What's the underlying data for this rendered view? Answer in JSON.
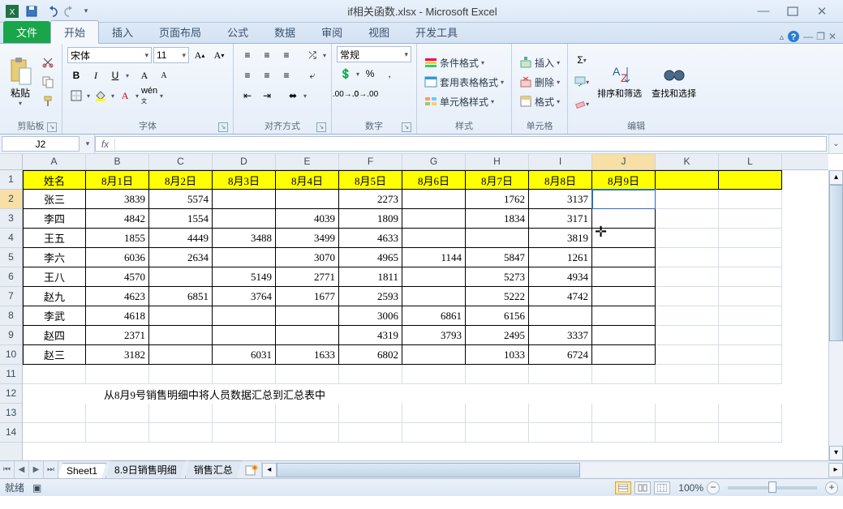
{
  "title_bar": {
    "doc_title": "if相关函数.xlsx - Microsoft Excel"
  },
  "ribbon": {
    "file_tab": "文件",
    "tabs": [
      "开始",
      "插入",
      "页面布局",
      "公式",
      "数据",
      "审阅",
      "视图",
      "开发工具"
    ],
    "active_tab": 0,
    "clipboard": {
      "label": "剪贴板",
      "paste": "粘贴"
    },
    "font": {
      "label": "字体",
      "name": "宋体",
      "size": "11",
      "bold": "B",
      "italic": "I",
      "underline": "U"
    },
    "alignment": {
      "label": "对齐方式"
    },
    "number": {
      "label": "数字",
      "format": "常规",
      "percent": "%"
    },
    "styles": {
      "label": "样式",
      "conditional": "条件格式",
      "table_format": "套用表格格式",
      "cell_styles": "单元格样式"
    },
    "cells": {
      "label": "单元格",
      "insert": "插入",
      "delete": "删除",
      "format": "格式"
    },
    "editing": {
      "label": "编辑",
      "sort": "排序和筛选",
      "find": "查找和选择"
    }
  },
  "formula_bar": {
    "name_box": "J2",
    "fx": "fx",
    "formula": ""
  },
  "grid": {
    "columns": [
      "A",
      "B",
      "C",
      "D",
      "E",
      "F",
      "G",
      "H",
      "I",
      "J",
      "K",
      "L"
    ],
    "active_col_index": 9,
    "row_headers": [
      1,
      2,
      3,
      4,
      5,
      6,
      7,
      8,
      9,
      10,
      11,
      12,
      13,
      14
    ],
    "active_row_index": 1,
    "header_row": [
      "姓名",
      "8月1日",
      "8月2日",
      "8月3日",
      "8月4日",
      "8月5日",
      "8月6日",
      "8月7日",
      "8月8日",
      "8月9日"
    ],
    "data_rows": [
      [
        "张三",
        "3839",
        "5574",
        "",
        "",
        "2273",
        "",
        "1762",
        "3137",
        ""
      ],
      [
        "李四",
        "4842",
        "1554",
        "",
        "4039",
        "1809",
        "",
        "1834",
        "3171",
        ""
      ],
      [
        "王五",
        "1855",
        "4449",
        "3488",
        "3499",
        "4633",
        "",
        "",
        "3819",
        ""
      ],
      [
        "李六",
        "6036",
        "2634",
        "",
        "3070",
        "4965",
        "1144",
        "5847",
        "1261",
        ""
      ],
      [
        "王八",
        "4570",
        "",
        "5149",
        "2771",
        "1811",
        "",
        "5273",
        "4934",
        ""
      ],
      [
        "赵九",
        "4623",
        "6851",
        "3764",
        "1677",
        "2593",
        "",
        "5222",
        "4742",
        ""
      ],
      [
        "李武",
        "4618",
        "",
        "",
        "",
        "3006",
        "6861",
        "6156",
        "",
        ""
      ],
      [
        "赵四",
        "2371",
        "",
        "",
        "",
        "4319",
        "3793",
        "2495",
        "3337",
        ""
      ],
      [
        "赵三",
        "3182",
        "",
        "6031",
        "1633",
        "6802",
        "",
        "1033",
        "6724",
        ""
      ]
    ],
    "selected": {
      "row": 2,
      "col": "J"
    },
    "note": "从8月9号销售明细中将人员数据汇总到汇总表中"
  },
  "sheet_tabs": {
    "sheets": [
      "Sheet1",
      "8.9日销售明细",
      "销售汇总"
    ],
    "active": 0
  },
  "status_bar": {
    "ready": "就绪",
    "zoom": "100%"
  },
  "chart_data": {
    "type": "table",
    "title": "8月1日–8月9日 人员销售明细",
    "columns": [
      "姓名",
      "8月1日",
      "8月2日",
      "8月3日",
      "8月4日",
      "8月5日",
      "8月6日",
      "8月7日",
      "8月8日",
      "8月9日"
    ],
    "rows": [
      {
        "姓名": "张三",
        "8月1日": 3839,
        "8月2日": 5574,
        "8月3日": null,
        "8月4日": null,
        "8月5日": 2273,
        "8月6日": null,
        "8月7日": 1762,
        "8月8日": 3137,
        "8月9日": null
      },
      {
        "姓名": "李四",
        "8月1日": 4842,
        "8月2日": 1554,
        "8月3日": null,
        "8月4日": 4039,
        "8月5日": 1809,
        "8月6日": null,
        "8月7日": 1834,
        "8月8日": 3171,
        "8月9日": null
      },
      {
        "姓名": "王五",
        "8月1日": 1855,
        "8月2日": 4449,
        "8月3日": 3488,
        "8月4日": 3499,
        "8月5日": 4633,
        "8月6日": null,
        "8月7日": null,
        "8月8日": 3819,
        "8月9日": null
      },
      {
        "姓名": "李六",
        "8月1日": 6036,
        "8月2日": 2634,
        "8月3日": null,
        "8月4日": 3070,
        "8月5日": 4965,
        "8月6日": 1144,
        "8月7日": 5847,
        "8月8日": 1261,
        "8月9日": null
      },
      {
        "姓名": "王八",
        "8月1日": 4570,
        "8月2日": null,
        "8月3日": 5149,
        "8月4日": 2771,
        "8月5日": 1811,
        "8月6日": null,
        "8月7日": 5273,
        "8月8日": 4934,
        "8月9日": null
      },
      {
        "姓名": "赵九",
        "8月1日": 4623,
        "8月2日": 6851,
        "8月3日": 3764,
        "8月4日": 1677,
        "8月5日": 2593,
        "8月6日": null,
        "8月7日": 5222,
        "8月8日": 4742,
        "8月9日": null
      },
      {
        "姓名": "李武",
        "8月1日": 4618,
        "8月2日": null,
        "8月3日": null,
        "8月4日": null,
        "8月5日": 3006,
        "8月6日": 6861,
        "8月7日": 6156,
        "8月8日": null,
        "8月9日": null
      },
      {
        "姓名": "赵四",
        "8月1日": 2371,
        "8月2日": null,
        "8月3日": null,
        "8月4日": null,
        "8月5日": 4319,
        "8月6日": 3793,
        "8月7日": 2495,
        "8月8日": 3337,
        "8月9日": null
      },
      {
        "姓名": "赵三",
        "8月1日": 3182,
        "8月2日": null,
        "8月3日": 6031,
        "8月4日": 1633,
        "8月5日": 6802,
        "8月6日": null,
        "8月7日": 1033,
        "8月8日": 6724,
        "8月9日": null
      }
    ]
  }
}
